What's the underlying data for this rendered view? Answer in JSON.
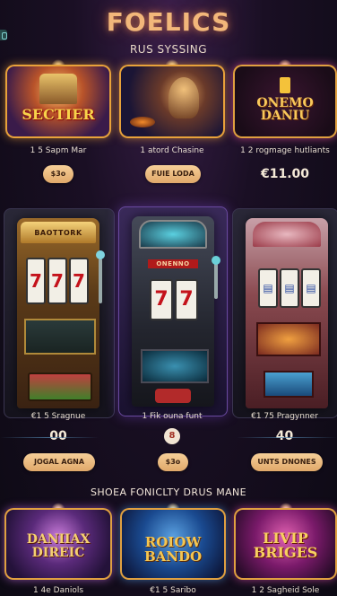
{
  "header": {
    "title": "FOELICS",
    "subtitle": "RUS SYSSING"
  },
  "top_row": [
    {
      "thumb_text": "SECTIER",
      "caption": "1 5 Sapm Mar",
      "button": "$3o",
      "price": ""
    },
    {
      "thumb_text": "",
      "caption": "1 atord Chasine",
      "button": "FUIE LODA",
      "price": ""
    },
    {
      "thumb_text": "ONEMO DANIU",
      "caption": "1 2 rogmage hutliants",
      "button": "",
      "price": "€11.00"
    }
  ],
  "machines": [
    {
      "sign": "BAOTTORK",
      "caption": "€1 5 Sragnue",
      "value": "00",
      "button": "JOGAL AGNA"
    },
    {
      "sign": "ONENNO",
      "caption": "1 Fik ouna funt",
      "value": "",
      "button": "$3o"
    },
    {
      "sign": "",
      "caption": "€1 75 Pragynner",
      "value": "40",
      "button": "UNTS DNONES"
    }
  ],
  "round_button": "8",
  "section2": {
    "title": "SHOEA FONICLTY DRUS MANE"
  },
  "bottom_row": [
    {
      "thumb_text": "DANIIAX DIREIC",
      "caption": "1 4e Daniols"
    },
    {
      "thumb_text": "ROIOW BANDO",
      "caption": "€1 5 Saribo"
    },
    {
      "thumb_text": "LIVIP BRIGES",
      "caption": "1 2 Sagheid Sole"
    }
  ],
  "colors": {
    "accent": "#e8a23a",
    "pill": "#f1c28a",
    "background": "#1a0f24"
  }
}
